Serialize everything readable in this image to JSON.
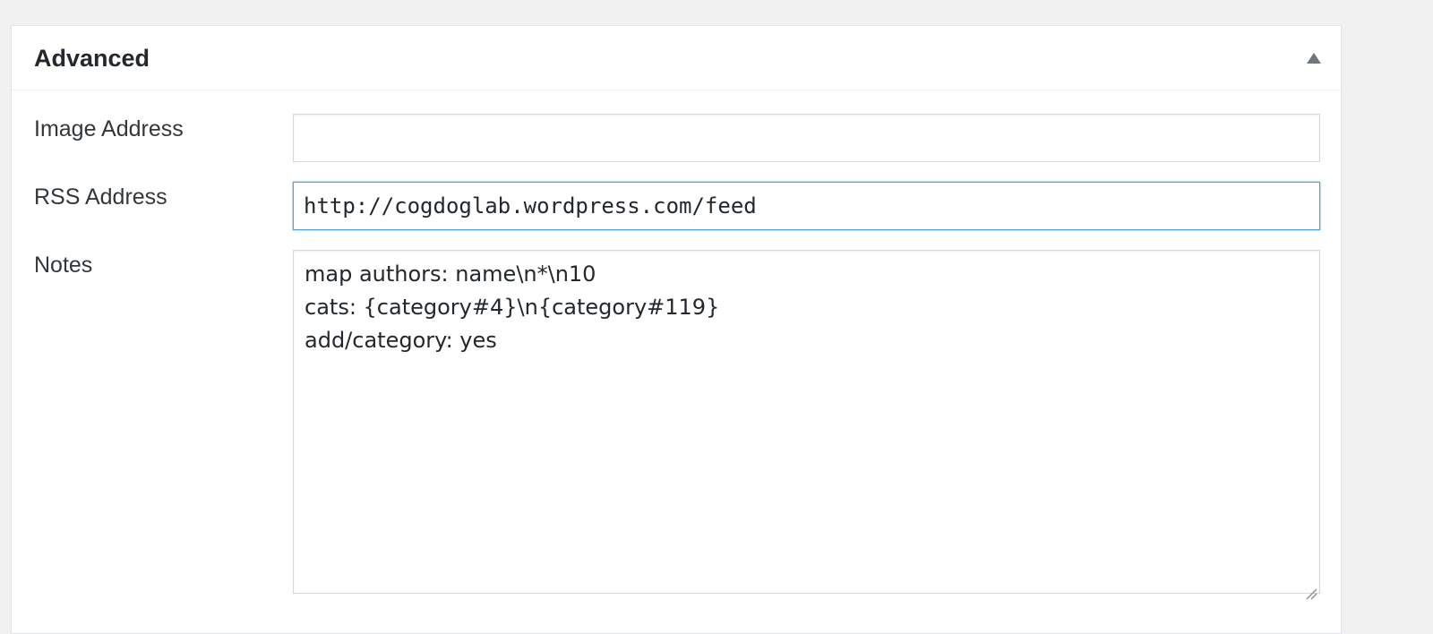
{
  "panel": {
    "title": "Advanced",
    "toggle_icon": "triangle-up-icon"
  },
  "fields": {
    "image_address": {
      "label": "Image Address",
      "value": ""
    },
    "rss_address": {
      "label": "RSS Address",
      "value": "http://cogdoglab.wordpress.com/feed"
    },
    "notes": {
      "label": "Notes",
      "lines": [
        "map authors: name\\n*\\n10",
        "cats: {category#4}\\n{category#119}",
        "add/category: yes"
      ]
    }
  },
  "colors": {
    "background": "#f1f1f1",
    "panel": "#ffffff",
    "focus_border": "#5b9dd9",
    "text": "#23282d"
  }
}
